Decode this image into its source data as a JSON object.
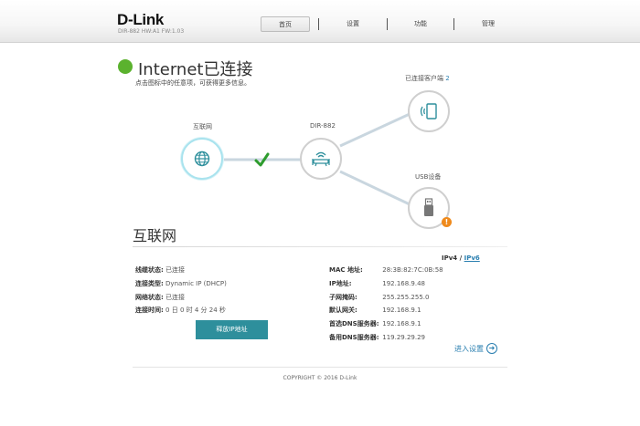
{
  "header": {
    "brand": "D-Link",
    "model_info": "DIR-882 HW:A1 FW:1.03",
    "nav": [
      "首页",
      "设置",
      "功能",
      "管理"
    ]
  },
  "status": {
    "title": "Internet已连接",
    "subtitle": "点击图标中的任意项，可获得更多信息。"
  },
  "diagram": {
    "internet_label": "互联网",
    "router_label": "DIR-882",
    "clients_label": "已连接客户端",
    "clients_count": "2",
    "usb_label": "USB设备",
    "warning_symbol": "!"
  },
  "internet": {
    "section_title": "互联网",
    "ipv4": "IPv4",
    "sep": "/",
    "ipv6": "IPv6",
    "left": [
      {
        "k": "线缆状态:",
        "v": "已连接"
      },
      {
        "k": "连接类型:",
        "v": "Dynamic IP (DHCP)"
      },
      {
        "k": "网络状态:",
        "v": "已连接"
      },
      {
        "k": "连接时间:",
        "v": "0 日 0 时 4 分 24 秒"
      }
    ],
    "right": [
      {
        "k": "MAC 地址:",
        "v": "28:3B:82:7C:0B:58"
      },
      {
        "k": "IP地址:",
        "v": "192.168.9.48"
      },
      {
        "k": "子网掩码:",
        "v": "255.255.255.0"
      },
      {
        "k": "默认网关:",
        "v": "192.168.9.1"
      },
      {
        "k": "首选DNS服务器:",
        "v": "192.168.9.1"
      },
      {
        "k": "备用DNS服务器:",
        "v": "119.29.29.29"
      }
    ],
    "renew_button": "释放IP地址",
    "advanced_link": "进入设置",
    "advanced_arrow": "➜"
  },
  "footer": {
    "copyright": "COPYRIGHT © 2016 D-Link"
  },
  "colors": {
    "accent": "#2e8f9c",
    "ok": "#5bb22e",
    "warning": "#ef8a1c",
    "link": "#2a7fb0"
  }
}
